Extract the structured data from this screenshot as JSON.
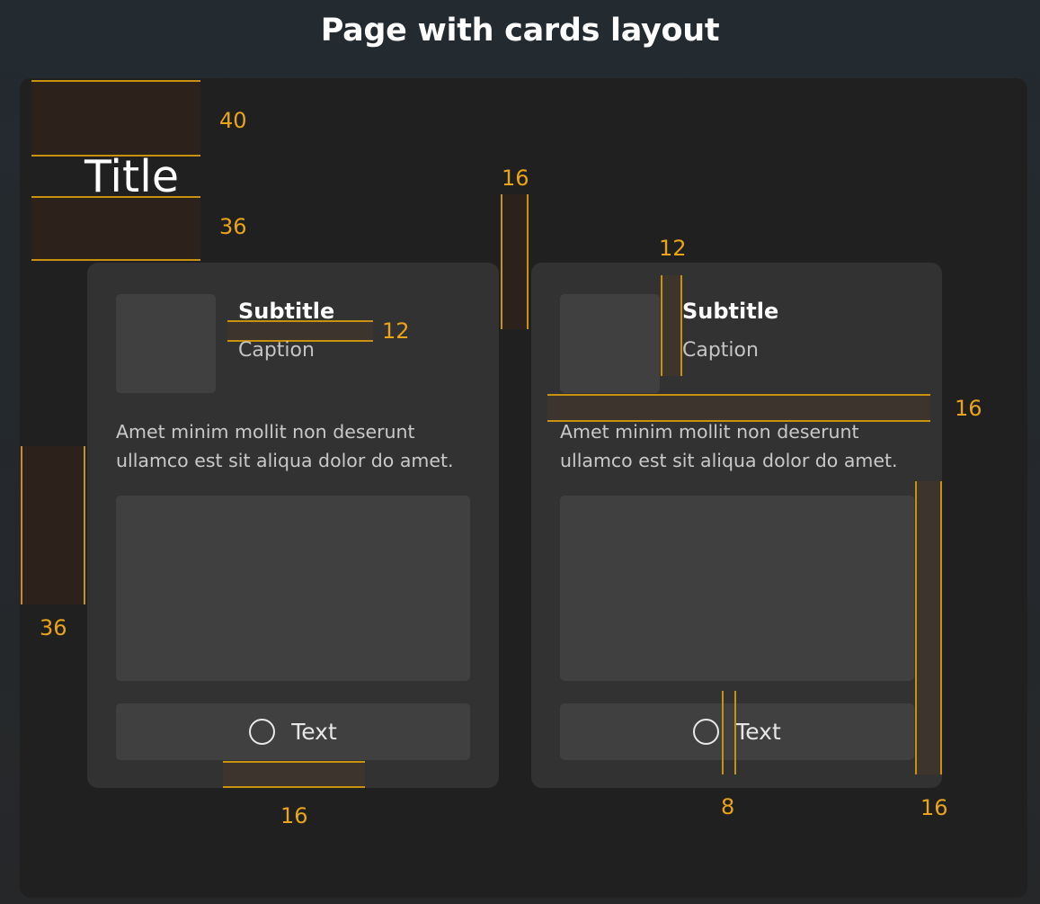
{
  "heading": "Page with cards layout",
  "title": "Title",
  "measurements": {
    "title_top_margin": "40",
    "title_bottom_margin": "36",
    "left_margin": "36",
    "card_gap": "16",
    "text_gap": "12",
    "icon_text_gap": "12",
    "header_gap": "16",
    "button_bottom_padding": "16",
    "button_icon_gap": "8",
    "card_padding": "16"
  },
  "cards": [
    {
      "subtitle": "Subtitle",
      "caption": "Caption",
      "body": "Amet minim mollit non deserunt ullamco est sit aliqua dolor do amet.",
      "button_label": "Text",
      "button_icon": "circle-icon"
    },
    {
      "subtitle": "Subtitle",
      "caption": "Caption",
      "body": "Amet minim mollit non deserunt ullamco est sit aliqua dolor do amet.",
      "button_label": "Text",
      "button_icon": "circle-icon"
    }
  ],
  "colors": {
    "annotation": "#e9a417",
    "page_background": "#202020",
    "card_background": "#323232",
    "placeholder": "#404040"
  }
}
